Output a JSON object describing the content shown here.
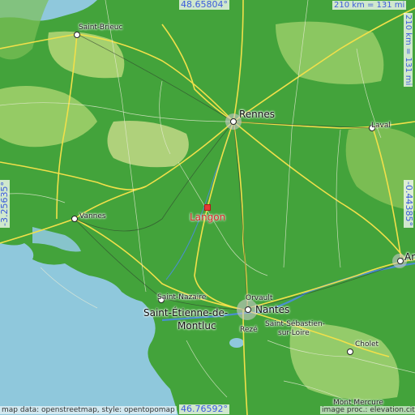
{
  "map": {
    "marker_label": "Langon",
    "coords": {
      "top": "48.65804°",
      "bottom": "46.76592°",
      "left": "-3.25635°",
      "right": "-0.44385°"
    },
    "scale": {
      "horizontal": "210 km = 131 mi",
      "vertical": "210 km = 131 mi"
    },
    "credits": {
      "left": "map data: openstreetmap, style: opentopomap",
      "right": "image proc.: elevation.city"
    },
    "cities": [
      {
        "id": "saint-brieuc",
        "label": "Saint-Brieuc",
        "size": "small"
      },
      {
        "id": "rennes",
        "label": "Rennes",
        "size": "big"
      },
      {
        "id": "laval",
        "label": "Laval",
        "size": "small"
      },
      {
        "id": "vannes",
        "label": "Vannes",
        "size": "small"
      },
      {
        "id": "saint-nazaire",
        "label": "Saint-Nazaire",
        "size": "small"
      },
      {
        "id": "saint-etienne-1",
        "label": "Saint-Étienne-de-",
        "size": "big"
      },
      {
        "id": "saint-etienne-2",
        "label": "Montluc",
        "size": "big"
      },
      {
        "id": "orvault",
        "label": "Orvault",
        "size": "small"
      },
      {
        "id": "nantes",
        "label": "Nantes",
        "size": "big"
      },
      {
        "id": "saint-sebastien-1",
        "label": "Saint-Sébastien-",
        "size": "small"
      },
      {
        "id": "saint-sebastien-2",
        "label": "sur-Loire",
        "size": "small"
      },
      {
        "id": "reze",
        "label": "Rezé",
        "size": "small"
      },
      {
        "id": "cholet",
        "label": "Cholet",
        "size": "small"
      },
      {
        "id": "angers",
        "label": "An",
        "size": "big"
      },
      {
        "id": "mont-mercure",
        "label": "Mont Mercure",
        "size": "small"
      }
    ]
  }
}
